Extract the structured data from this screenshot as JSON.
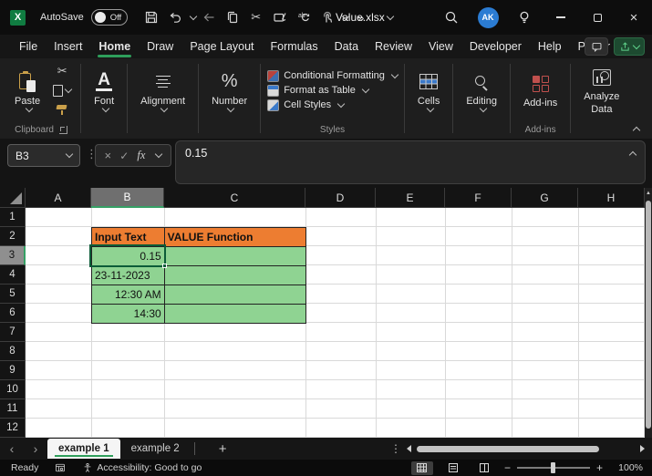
{
  "window": {
    "title": "Value.xlsx"
  },
  "titlebar": {
    "autosave_label": "AutoSave",
    "autosave_state": "Off",
    "avatar_initials": "AK"
  },
  "menubar": {
    "tabs": [
      "File",
      "Insert",
      "Home",
      "Draw",
      "Page Layout",
      "Formulas",
      "Data",
      "Review",
      "View",
      "Developer",
      "Help",
      "Power Pivot"
    ],
    "active_tab": "Home"
  },
  "ribbon": {
    "paste": "Paste",
    "font": "Font",
    "alignment": "Alignment",
    "number": "Number",
    "conditional_formatting": "Conditional Formatting",
    "format_as_table": "Format as Table",
    "cell_styles": "Cell Styles",
    "styles_group": "Styles",
    "clipboard_group": "Clipboard",
    "cells": "Cells",
    "editing": "Editing",
    "addins": "Add-ins",
    "addins_group": "Add-ins",
    "analyze_data_line1": "Analyze",
    "analyze_data_line2": "Data"
  },
  "formula_bar": {
    "name_box": "B3",
    "fx": "fx",
    "value": "0.15"
  },
  "grid": {
    "selected_cell": "B3",
    "columns": [
      "A",
      "B",
      "C",
      "D",
      "E",
      "F",
      "G",
      "H"
    ],
    "rows": [
      "1",
      "2",
      "3",
      "4",
      "5",
      "6",
      "7",
      "8",
      "9",
      "10",
      "11",
      "12"
    ],
    "table": {
      "headers": [
        "Input Text",
        "VALUE Function"
      ],
      "rows": [
        [
          "0.15",
          ""
        ],
        [
          "23-11-2023",
          ""
        ],
        [
          "12:30 AM",
          ""
        ],
        [
          "14:30",
          ""
        ]
      ],
      "header_fill": "#ED7D31",
      "body_fill": "#8FD392"
    }
  },
  "sheets": {
    "tabs": [
      "example 1",
      "example 2"
    ]
  },
  "status": {
    "ready": "Ready",
    "accessibility": "Accessibility: Good to go",
    "zoom": "100%"
  },
  "colors": {
    "accent_green": "#2E9E5B",
    "selection_border": "#0C5C38"
  }
}
